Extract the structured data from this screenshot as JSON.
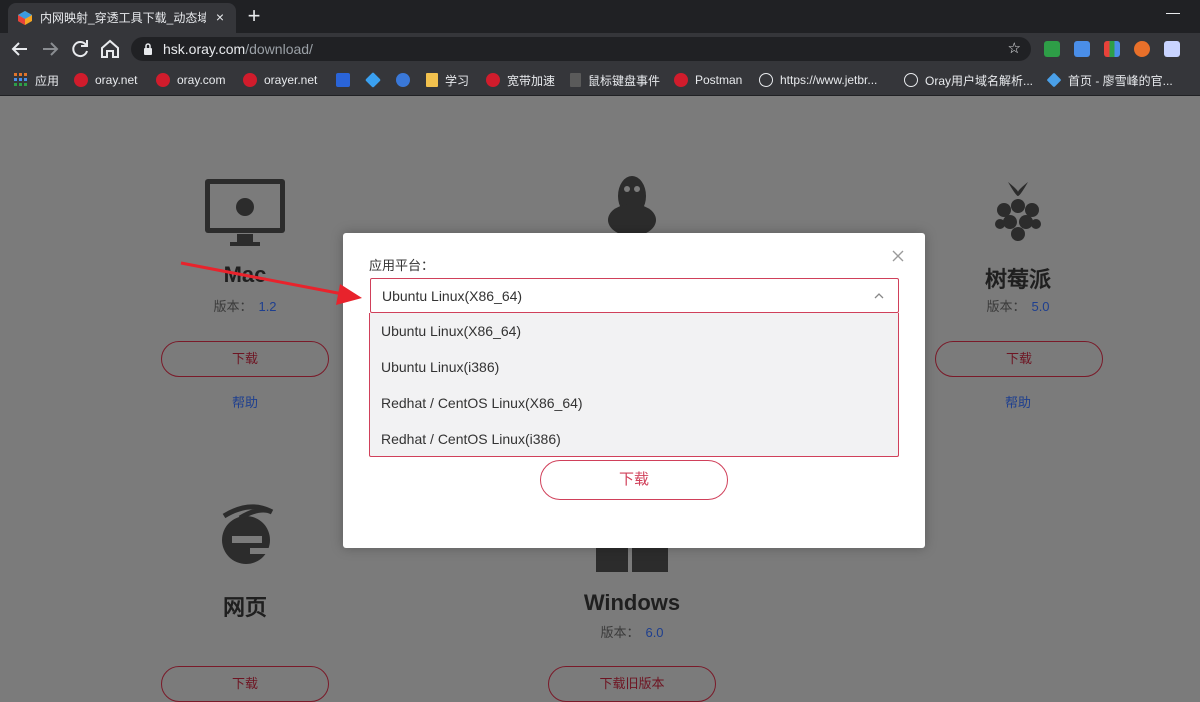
{
  "browser": {
    "tab_title": "内网映射_穿透工具下载_动态域名",
    "url_host": "hsk.oray.com",
    "url_path": "/download/",
    "new_tab_symbol": "+",
    "close_symbol": "×",
    "icons": {
      "back": "arrow-left-icon",
      "forward": "arrow-right-icon",
      "reload": "reload-icon",
      "home": "home-icon",
      "star": "star-icon",
      "lock": "lock-icon"
    },
    "bookmarks": [
      {
        "label": "应用",
        "icon": "apps-grid-icon",
        "color": "#e0742a"
      },
      {
        "label": "oray.net",
        "icon": "oray-icon",
        "color": "#d11c2c"
      },
      {
        "label": "oray.com",
        "icon": "oray-icon",
        "color": "#d11c2c"
      },
      {
        "label": "orayer.net",
        "icon": "oray-icon",
        "color": "#d11c2c"
      },
      {
        "label": "",
        "icon": "baidu-icon",
        "color": "#2a64d8"
      },
      {
        "label": "",
        "icon": "diamond-icon",
        "color": "#3aa0f0"
      },
      {
        "label": "",
        "icon": "circle-e-icon",
        "color": "#3a78d8"
      },
      {
        "label": "学习",
        "icon": "folder-icon",
        "color": "#f2c14e"
      },
      {
        "label": "宽带加速",
        "icon": "oray-icon",
        "color": "#d11c2c"
      },
      {
        "label": "鼠标键盘事件",
        "icon": "page-icon",
        "color": "#5a5a5a"
      },
      {
        "label": "Postman",
        "icon": "postman-icon",
        "color": "#d11c2c"
      },
      {
        "label": "https://www.jetbr...",
        "icon": "globe-icon",
        "color": "#e8eaed"
      },
      {
        "label": "Oray用户域名解析...",
        "icon": "globe-icon",
        "color": "#e8eaed"
      },
      {
        "label": "首页 - 廖雪峰的官...",
        "icon": "rocket-icon",
        "color": "#4aa0e8"
      }
    ]
  },
  "page": {
    "mac": {
      "title": "Mac",
      "version_label": "版本：",
      "version": "1.2",
      "button": "下载",
      "help": "帮助"
    },
    "raspberry": {
      "title": "树莓派",
      "version_label": "版本：",
      "version": "5.0",
      "button": "下载",
      "help": "帮助"
    },
    "web": {
      "title": "网页",
      "button": "下载"
    },
    "windows": {
      "title": "Windows",
      "version_label": "版本：",
      "version": "6.0",
      "button": "下载旧版本"
    }
  },
  "modal": {
    "label": "应用平台：",
    "selected": "Ubuntu Linux(X86_64)",
    "options": [
      "Ubuntu Linux(X86_64)",
      "Ubuntu Linux(i386)",
      "Redhat / CentOS Linux(X86_64)",
      "Redhat / CentOS Linux(i386)"
    ],
    "download_button": "下载"
  },
  "colors": {
    "accent": "#d0405a",
    "annotation_arrow": "#e8232c"
  }
}
